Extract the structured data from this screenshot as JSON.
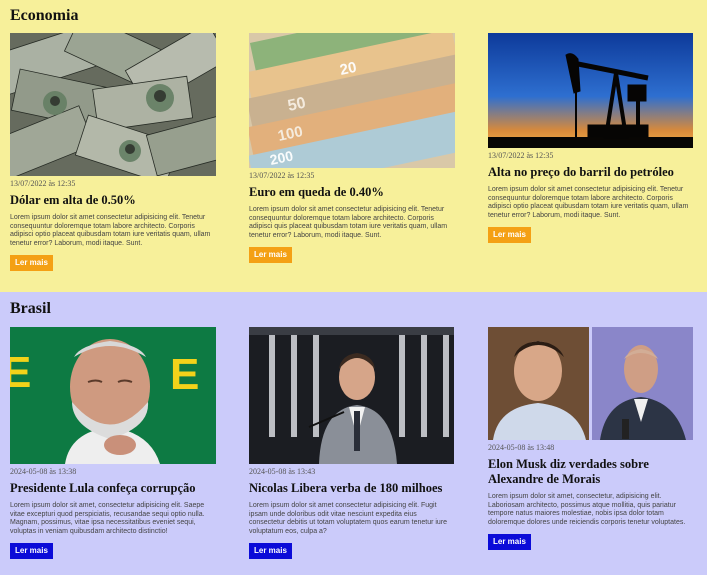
{
  "sections": [
    {
      "title": "Economia",
      "button_color": "#f4a014",
      "articles": [
        {
          "image": "dollar-bills-image",
          "date": "13/07/2022 às 12:35",
          "title": "Dólar em alta de 0.50%",
          "body": "Lorem ipsum dolor sit amet consectetur adipisicing elit. Tenetur consequuntur doloremque totam labore architecto. Corporis adipisci optio placeat quibusdam totam iure veritatis quam, ullam tenetur error? Laborum, modi itaque. Sunt.",
          "button": "Ler mais"
        },
        {
          "image": "euro-banknotes-image",
          "date": "13/07/2022 às 12:35",
          "title": "Euro em queda de 0.40%",
          "body": "Lorem ipsum dolor sit amet consectetur adipisicing elit. Tenetur consequuntur doloremque totam labore architecto. Corporis adipisci quis placeat quibusdam totam iure veritatis quam, ullam tenetur error? Laborum, modi itaque. Sunt.",
          "button": "Ler mais"
        },
        {
          "image": "oil-pumpjack-image",
          "date": "13/07/2022 às 12:35",
          "title": "Alta no preço do barril do petróleo",
          "body": "Lorem ipsum dolor sit amet consectetur adipisicing elit. Tenetur consequuntur doloremque totam labore architecto. Corporis adipisci optio placeat quibusdam totam iure veritatis quam, ullam tenetur error? Laborum, modi itaque. Sunt.",
          "button": "Ler mais"
        }
      ]
    },
    {
      "title": "Brasil",
      "button_color": "#0b0bd8",
      "articles": [
        {
          "image": "lula-photo",
          "date": "2024-05-08 às 13:38",
          "title": "Presidente Lula confeça corrupção",
          "body": "Lorem ipsum dolor sit amet, consectetur adipisicing elit. Saepe vitae excepturi quod perspiciatis, recusandae sequi optio nulla. Magnam, possimus, vitae ipsa necessitatibus eveniet sequi, voluptas in veniam quibusdam architecto distinctio!",
          "button": "Ler mais"
        },
        {
          "image": "nicolas-speaking-photo",
          "date": "2024-05-08 às 13:43",
          "title": "Nicolas Libera verba de 180 milhoes",
          "body": "Lorem ipsum dolor sit amet consectetur adipisicing elit. Fugit ipsam unde doloribus odit vitae nesciunt expedita eius consectetur debitis ut totam voluptatem quos earum tenetur iure voluptatum eos, culpa a?",
          "button": "Ler mais"
        },
        {
          "image": "musk-moraes-photo",
          "date": "2024-05-08 às 13:48",
          "title": "Elon Musk diz verdades sobre Alexandre de Morais",
          "body": "Lorem ipsum dolor sit amet, consectetur, adipisicing elit. Laboriosam architecto, possimus atque mollitia, quis pariatur tempore natus maiores molestiae, nobis ipsa dolor totam doloremque dolores unde reiciendis corporis tenetur voluptates.",
          "button": "Ler mais"
        }
      ]
    }
  ]
}
